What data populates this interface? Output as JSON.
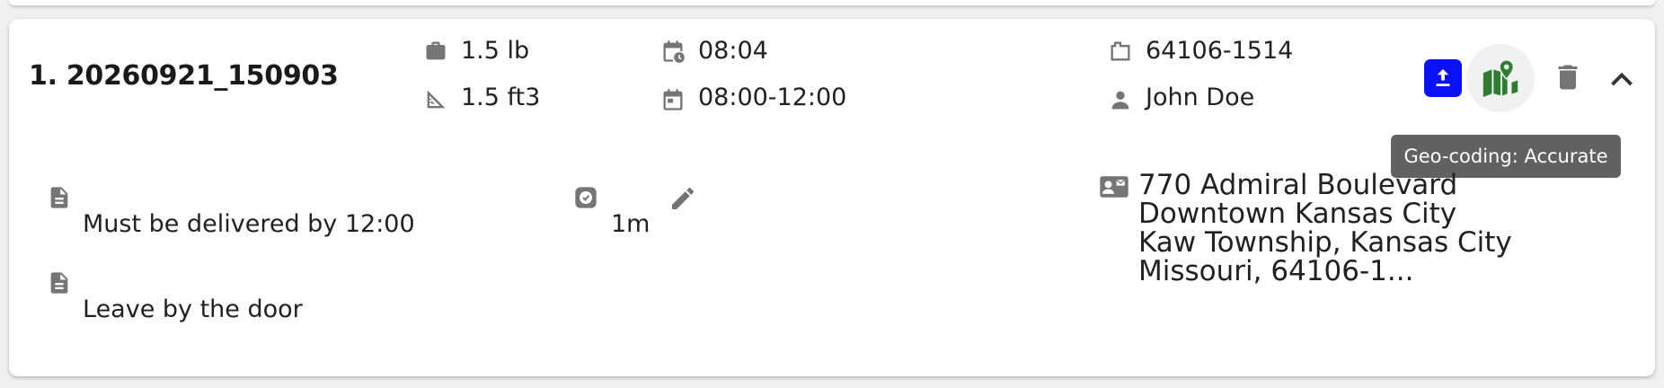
{
  "stop": {
    "title": "1. 20260921_150903",
    "weight": "1.5 lb",
    "volume": "1.5 ft3",
    "eta": "08:04",
    "time_window": "08:00-12:00",
    "postal_code": "64106-1514",
    "customer_name": "John Doe",
    "notes": [
      "Must be delivered by 12:00",
      "Leave by the door"
    ],
    "service_time": "1m",
    "address_lines": [
      "770 Admiral Boulevard",
      "Downtown Kansas City",
      "Kaw Township, Kansas City",
      "Missouri, 64106-1..."
    ]
  },
  "actions": {
    "geocoding_tooltip": "Geo-coding: Accurate"
  },
  "icons": {
    "weight": "briefcase-icon",
    "volume": "set-square-icon",
    "eta": "calendar-clock-icon",
    "time_window": "calendar-icon",
    "postal_code": "mailbox-icon",
    "customer": "person-icon",
    "notes": "document-icon",
    "service_time": "clock-check-icon",
    "edit": "pencil-icon",
    "address": "contact-card-icon",
    "upload": "upload-icon",
    "map": "map-pin-icon",
    "delete": "trash-icon",
    "collapse": "chevron-up-icon"
  },
  "colors": {
    "upload_button": "#0a12f5",
    "map_icon": "#2e7d32",
    "icon_gray": "#757575",
    "tooltip_bg": "#616161"
  }
}
